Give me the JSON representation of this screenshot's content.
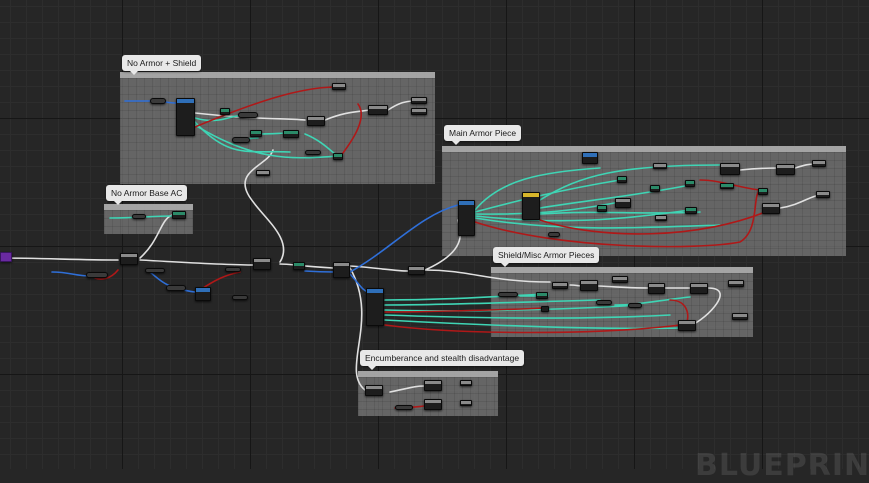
{
  "graph": {
    "comments": [
      {
        "id": "no-armor-shield",
        "title": "No Armor + Shield"
      },
      {
        "id": "no-armor-base-ac",
        "title": "No Armor Base AC"
      },
      {
        "id": "main-armor-piece",
        "title": "Main Armor Piece"
      },
      {
        "id": "shield-misc",
        "title": "Shield/Misc Armor Pieces"
      },
      {
        "id": "encumberance",
        "title": "Encumberance and stealth disadvantage"
      }
    ],
    "watermark": "BLUEPRINT"
  },
  "colors": {
    "exec_wire": "#e8e8e8",
    "float_wire": "#3fd5b5",
    "bool_wire": "#b01818",
    "object_wire": "#2f6fd8",
    "comment_bg": "#808080",
    "graph_bg": "#262626"
  }
}
